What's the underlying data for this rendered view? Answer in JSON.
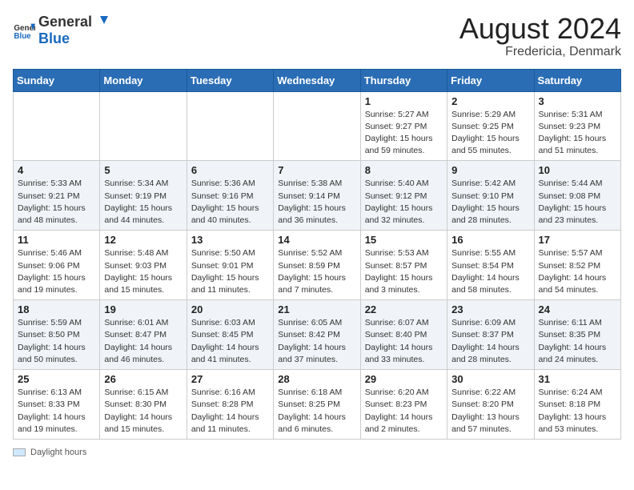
{
  "header": {
    "logo_general": "General",
    "logo_blue": "Blue",
    "title": "August 2024",
    "subtitle": "Fredericia, Denmark"
  },
  "weekdays": [
    "Sunday",
    "Monday",
    "Tuesday",
    "Wednesday",
    "Thursday",
    "Friday",
    "Saturday"
  ],
  "footer": {
    "legend_label": "Daylight hours"
  },
  "weeks": [
    [
      {
        "day": "",
        "info": ""
      },
      {
        "day": "",
        "info": ""
      },
      {
        "day": "",
        "info": ""
      },
      {
        "day": "",
        "info": ""
      },
      {
        "day": "1",
        "info": "Sunrise: 5:27 AM\nSunset: 9:27 PM\nDaylight: 15 hours\nand 59 minutes."
      },
      {
        "day": "2",
        "info": "Sunrise: 5:29 AM\nSunset: 9:25 PM\nDaylight: 15 hours\nand 55 minutes."
      },
      {
        "day": "3",
        "info": "Sunrise: 5:31 AM\nSunset: 9:23 PM\nDaylight: 15 hours\nand 51 minutes."
      }
    ],
    [
      {
        "day": "4",
        "info": "Sunrise: 5:33 AM\nSunset: 9:21 PM\nDaylight: 15 hours\nand 48 minutes."
      },
      {
        "day": "5",
        "info": "Sunrise: 5:34 AM\nSunset: 9:19 PM\nDaylight: 15 hours\nand 44 minutes."
      },
      {
        "day": "6",
        "info": "Sunrise: 5:36 AM\nSunset: 9:16 PM\nDaylight: 15 hours\nand 40 minutes."
      },
      {
        "day": "7",
        "info": "Sunrise: 5:38 AM\nSunset: 9:14 PM\nDaylight: 15 hours\nand 36 minutes."
      },
      {
        "day": "8",
        "info": "Sunrise: 5:40 AM\nSunset: 9:12 PM\nDaylight: 15 hours\nand 32 minutes."
      },
      {
        "day": "9",
        "info": "Sunrise: 5:42 AM\nSunset: 9:10 PM\nDaylight: 15 hours\nand 28 minutes."
      },
      {
        "day": "10",
        "info": "Sunrise: 5:44 AM\nSunset: 9:08 PM\nDaylight: 15 hours\nand 23 minutes."
      }
    ],
    [
      {
        "day": "11",
        "info": "Sunrise: 5:46 AM\nSunset: 9:06 PM\nDaylight: 15 hours\nand 19 minutes."
      },
      {
        "day": "12",
        "info": "Sunrise: 5:48 AM\nSunset: 9:03 PM\nDaylight: 15 hours\nand 15 minutes."
      },
      {
        "day": "13",
        "info": "Sunrise: 5:50 AM\nSunset: 9:01 PM\nDaylight: 15 hours\nand 11 minutes."
      },
      {
        "day": "14",
        "info": "Sunrise: 5:52 AM\nSunset: 8:59 PM\nDaylight: 15 hours\nand 7 minutes."
      },
      {
        "day": "15",
        "info": "Sunrise: 5:53 AM\nSunset: 8:57 PM\nDaylight: 15 hours\nand 3 minutes."
      },
      {
        "day": "16",
        "info": "Sunrise: 5:55 AM\nSunset: 8:54 PM\nDaylight: 14 hours\nand 58 minutes."
      },
      {
        "day": "17",
        "info": "Sunrise: 5:57 AM\nSunset: 8:52 PM\nDaylight: 14 hours\nand 54 minutes."
      }
    ],
    [
      {
        "day": "18",
        "info": "Sunrise: 5:59 AM\nSunset: 8:50 PM\nDaylight: 14 hours\nand 50 minutes."
      },
      {
        "day": "19",
        "info": "Sunrise: 6:01 AM\nSunset: 8:47 PM\nDaylight: 14 hours\nand 46 minutes."
      },
      {
        "day": "20",
        "info": "Sunrise: 6:03 AM\nSunset: 8:45 PM\nDaylight: 14 hours\nand 41 minutes."
      },
      {
        "day": "21",
        "info": "Sunrise: 6:05 AM\nSunset: 8:42 PM\nDaylight: 14 hours\nand 37 minutes."
      },
      {
        "day": "22",
        "info": "Sunrise: 6:07 AM\nSunset: 8:40 PM\nDaylight: 14 hours\nand 33 minutes."
      },
      {
        "day": "23",
        "info": "Sunrise: 6:09 AM\nSunset: 8:37 PM\nDaylight: 14 hours\nand 28 minutes."
      },
      {
        "day": "24",
        "info": "Sunrise: 6:11 AM\nSunset: 8:35 PM\nDaylight: 14 hours\nand 24 minutes."
      }
    ],
    [
      {
        "day": "25",
        "info": "Sunrise: 6:13 AM\nSunset: 8:33 PM\nDaylight: 14 hours\nand 19 minutes."
      },
      {
        "day": "26",
        "info": "Sunrise: 6:15 AM\nSunset: 8:30 PM\nDaylight: 14 hours\nand 15 minutes."
      },
      {
        "day": "27",
        "info": "Sunrise: 6:16 AM\nSunset: 8:28 PM\nDaylight: 14 hours\nand 11 minutes."
      },
      {
        "day": "28",
        "info": "Sunrise: 6:18 AM\nSunset: 8:25 PM\nDaylight: 14 hours\nand 6 minutes."
      },
      {
        "day": "29",
        "info": "Sunrise: 6:20 AM\nSunset: 8:23 PM\nDaylight: 14 hours\nand 2 minutes."
      },
      {
        "day": "30",
        "info": "Sunrise: 6:22 AM\nSunset: 8:20 PM\nDaylight: 13 hours\nand 57 minutes."
      },
      {
        "day": "31",
        "info": "Sunrise: 6:24 AM\nSunset: 8:18 PM\nDaylight: 13 hours\nand 53 minutes."
      }
    ]
  ]
}
